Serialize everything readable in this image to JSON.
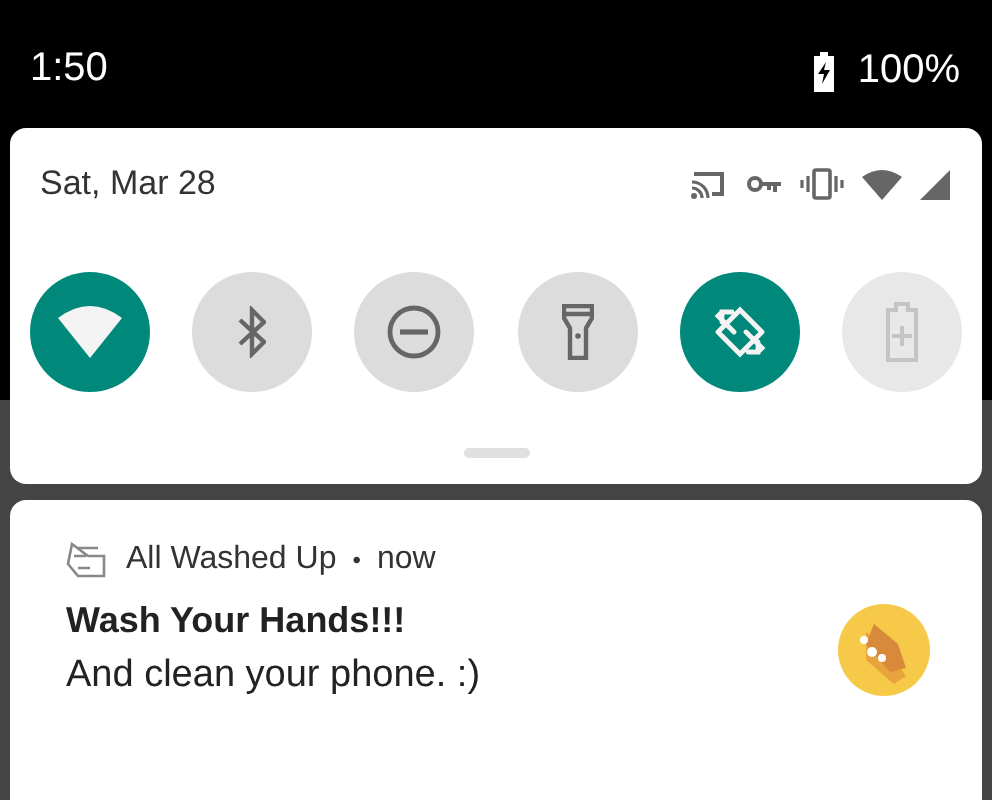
{
  "status_bar": {
    "time": "1:50",
    "battery": "100%"
  },
  "quick_settings": {
    "date": "Sat, Mar 28",
    "tiles": [
      {
        "kind": "wifi",
        "on": true,
        "disabled": false
      },
      {
        "kind": "bluetooth",
        "on": false,
        "disabled": false
      },
      {
        "kind": "dnd",
        "on": false,
        "disabled": false
      },
      {
        "kind": "flashlight",
        "on": false,
        "disabled": false
      },
      {
        "kind": "rotate",
        "on": true,
        "disabled": false
      },
      {
        "kind": "battery",
        "on": false,
        "disabled": true
      }
    ]
  },
  "notification": {
    "app": "All Washed Up",
    "separator": "•",
    "time": "now",
    "title": "Wash Your Hands!!!",
    "text": "And clean your phone. :)"
  }
}
